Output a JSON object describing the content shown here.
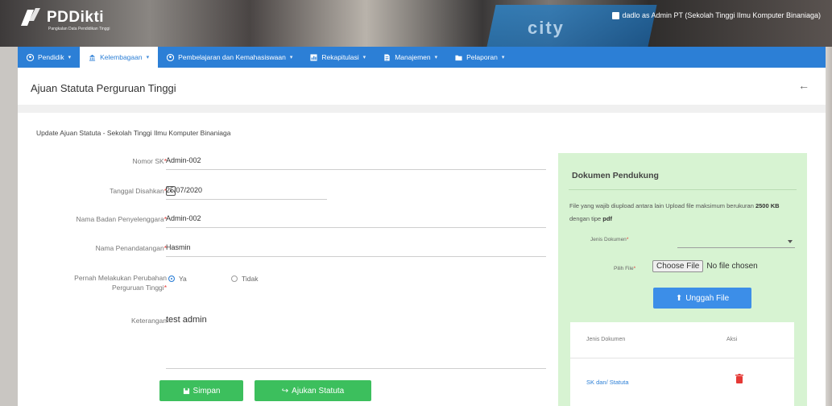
{
  "header": {
    "brand": "PDDikti",
    "tagline": "Pangkalan Data Pendidikan Tinggi",
    "background_word": "city",
    "user": "dadlo as Admin PT (Sekolah Tinggi Ilmu Komputer Binaniaga)"
  },
  "nav": {
    "items": [
      {
        "label": "Pendidik",
        "icon": "user-circle-icon"
      },
      {
        "label": "Kelembagaan",
        "icon": "institution-icon"
      },
      {
        "label": "Pembelajaran dan Kemahasiswaan",
        "icon": "user-circle-icon"
      },
      {
        "label": "Rekapitulasi",
        "icon": "chart-icon"
      },
      {
        "label": "Manajemen",
        "icon": "document-icon"
      },
      {
        "label": "Pelaporan",
        "icon": "folder-icon"
      }
    ],
    "active_index": 1
  },
  "page": {
    "title": "Ajuan Statuta Perguruan Tinggi",
    "subtitle": "Update Ajuan Statuta - Sekolah Tinggi Ilmu Komputer Binaniaga"
  },
  "form": {
    "nomor_sk": {
      "label": "Nomor SK",
      "value": "Admin-002"
    },
    "tanggal": {
      "label": "Tanggal Disahkan",
      "value": "25/07/2020"
    },
    "badan": {
      "label": "Nama Badan Penyelenggara",
      "value": "Admin-002"
    },
    "penandatangan": {
      "label": "Nama Penandatangan",
      "value": "Hasmin"
    },
    "perubahan": {
      "label_line1": "Pernah Melakukan Perubahan",
      "label_line2": "Perguruan Tinggi",
      "option_yes": "Ya",
      "option_no": "Tidak",
      "selected": "Ya"
    },
    "keterangan": {
      "label": "Keterangan",
      "value": "test admin"
    },
    "save_label": "Simpan",
    "submit_label": "Ajukan Statuta"
  },
  "side": {
    "title": "Dokumen Pendukung",
    "info_prefix": "File yang wajib diupload antara lain Upload file maksimum berukuran ",
    "info_size": "2500 KB",
    "info_middle": " dengan tipe ",
    "info_type": "pdf",
    "jenis_label": "Jenis Dokumen",
    "file_label": "Pilih File",
    "choose_label": "Choose File",
    "no_file": "No file chosen",
    "upload_label": "Unggah File",
    "table_headers": [
      "Jenis Dokumen",
      "Aksi"
    ],
    "rows": [
      {
        "jenis": "SK dan/ Statuta"
      }
    ]
  },
  "colors": {
    "primary": "#2c7fd6",
    "success": "#3cbf5d",
    "panel": "#d7f3d2",
    "danger": "#e53935"
  }
}
